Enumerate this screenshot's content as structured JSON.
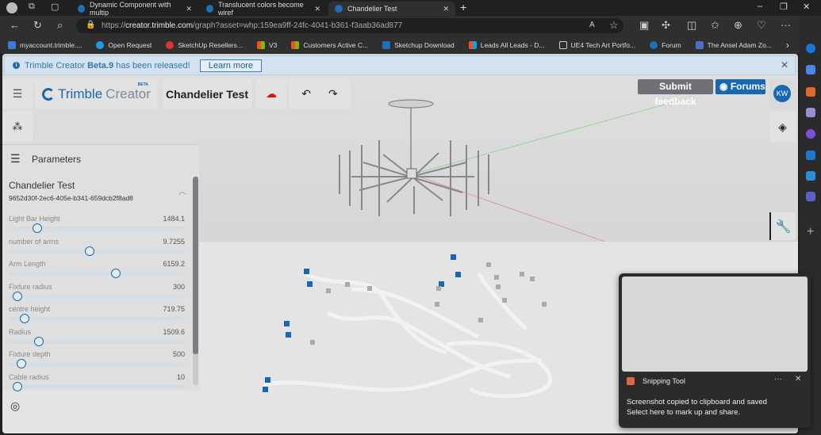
{
  "browser": {
    "tabs": [
      {
        "title": "Dynamic Component with multip",
        "active": false
      },
      {
        "title": "Translucent colors become wiref",
        "active": false
      },
      {
        "title": "Chandelier Test",
        "active": true
      }
    ],
    "url_prefix": "https://",
    "url_host": "creator.trimble.com",
    "url_path": "/graph?asset=whp:159ea9ff-24fc-4041-b361-f3aab36ad877",
    "bookmarks": [
      "myaccount.trimble....",
      "Open Request",
      "SketchUp Resellers...",
      "V3",
      "Customers Active C...",
      "Sketchup Download",
      "Leads All Leads - D...",
      "UE4 Tech Art Portfo...",
      "Forum",
      "The Ansel Adam Zo..."
    ]
  },
  "banner": {
    "prefix": "Trimble Creator ",
    "bold": "Beta.9",
    "suffix": " has been released!",
    "button": "Learn more"
  },
  "app": {
    "logo_main": "Trimble",
    "logo_sub": "Creator",
    "logo_badge": "BETA",
    "doc_title": "Chandelier Test",
    "feedback": "Submit feedback",
    "forums": "Forums",
    "avatar": "KW",
    "accent": "#1768b0"
  },
  "panel": {
    "title": "Parameters",
    "component": "Chandelier Test",
    "id": "9652d30f-2ec6-405e-b341-659dcb2f8ad8",
    "params": [
      {
        "label": "Light Bar Height",
        "value": "1484.1",
        "fraction": 0.16
      },
      {
        "label": "number of arms",
        "value": "9.7255",
        "fraction": 0.46
      },
      {
        "label": "Arm Length",
        "value": "6159.2",
        "fraction": 0.61
      },
      {
        "label": "Fixture radius",
        "value": "300",
        "fraction": 0.05
      },
      {
        "label": "centre height",
        "value": "719.75",
        "fraction": 0.09
      },
      {
        "label": "Radius",
        "value": "1509.6",
        "fraction": 0.17
      },
      {
        "label": "Fixture depth",
        "value": "500",
        "fraction": 0.07
      },
      {
        "label": "Cable radius",
        "value": "10",
        "fraction": 0.05
      }
    ]
  },
  "snip": {
    "app": "Snipping Tool",
    "line1": "Screenshot copied to clipboard and saved",
    "line2": "Select here to mark up and share."
  }
}
